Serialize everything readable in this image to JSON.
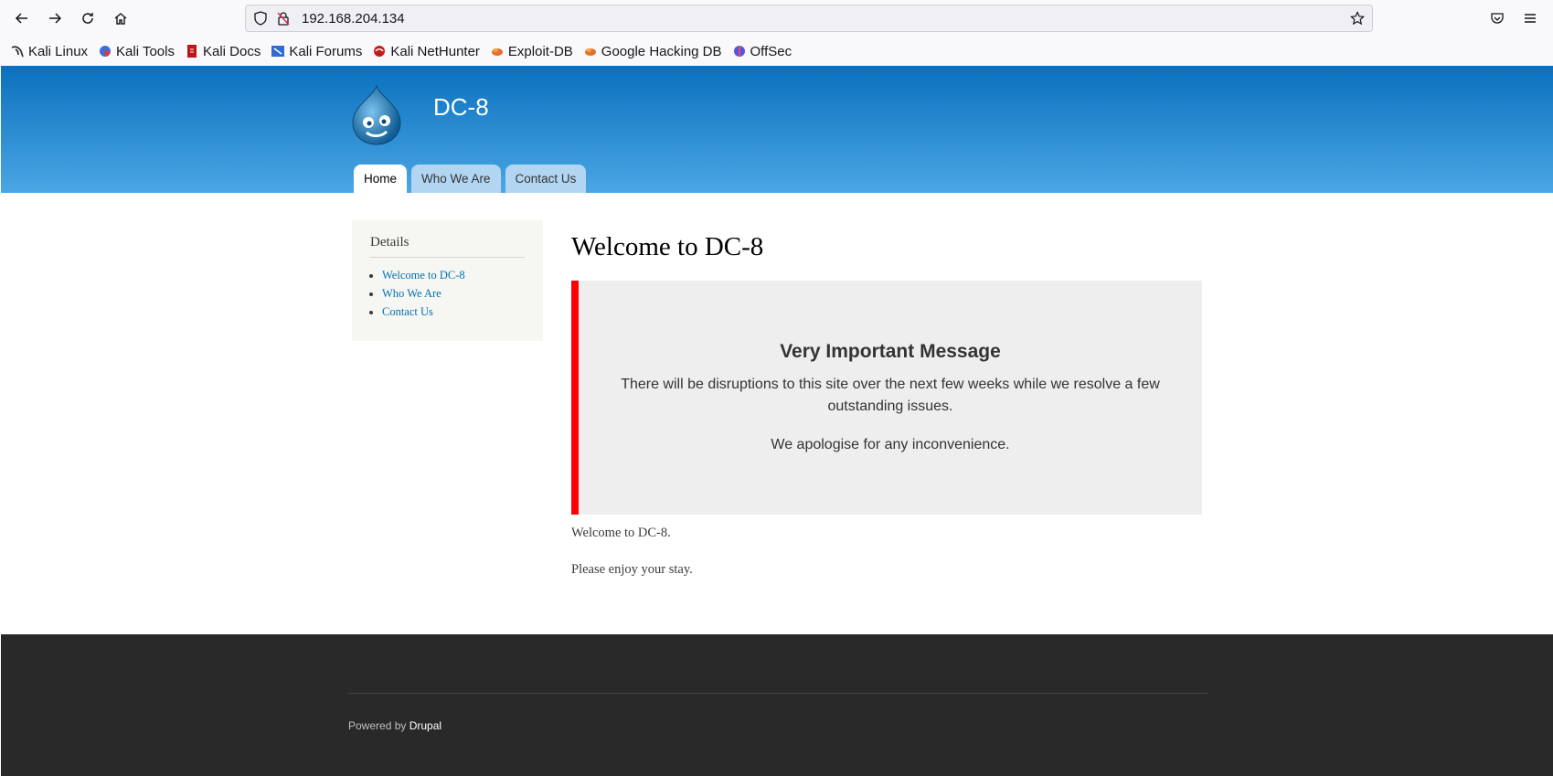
{
  "browser": {
    "url": "192.168.204.134",
    "bookmarks": [
      {
        "label": "Kali Linux",
        "icon": "kali-dragon-icon"
      },
      {
        "label": "Kali Tools",
        "icon": "kali-tools-icon"
      },
      {
        "label": "Kali Docs",
        "icon": "kali-docs-icon"
      },
      {
        "label": "Kali Forums",
        "icon": "kali-forums-icon"
      },
      {
        "label": "Kali NetHunter",
        "icon": "kali-nethunter-icon"
      },
      {
        "label": "Exploit-DB",
        "icon": "exploit-db-icon"
      },
      {
        "label": "Google Hacking DB",
        "icon": "ghdb-icon"
      },
      {
        "label": "OffSec",
        "icon": "offsec-icon"
      }
    ]
  },
  "site": {
    "name": "DC-8",
    "tabs": [
      "Home",
      "Who We Are",
      "Contact Us"
    ],
    "active_tab": "Home"
  },
  "sidebar": {
    "title": "Details",
    "links": [
      "Welcome to DC-8",
      "Who We Are",
      "Contact Us"
    ]
  },
  "main": {
    "title": "Welcome to DC-8",
    "message_heading": "Very Important Message",
    "message_line1": "There will be disruptions to this site over the next few weeks while we resolve a few outstanding issues.",
    "message_line2": "We apologise for any inconvenience.",
    "paragraph1": "Welcome to DC-8.",
    "paragraph2": "Please enjoy your stay."
  },
  "footer": {
    "powered_by": "Powered by",
    "cms": "Drupal"
  },
  "colors": {
    "header_top": "#0a70be",
    "header_bottom": "#4ba6e4",
    "alert_border": "#ff0000",
    "link": "#0071b3",
    "footer_bg": "#292929"
  }
}
